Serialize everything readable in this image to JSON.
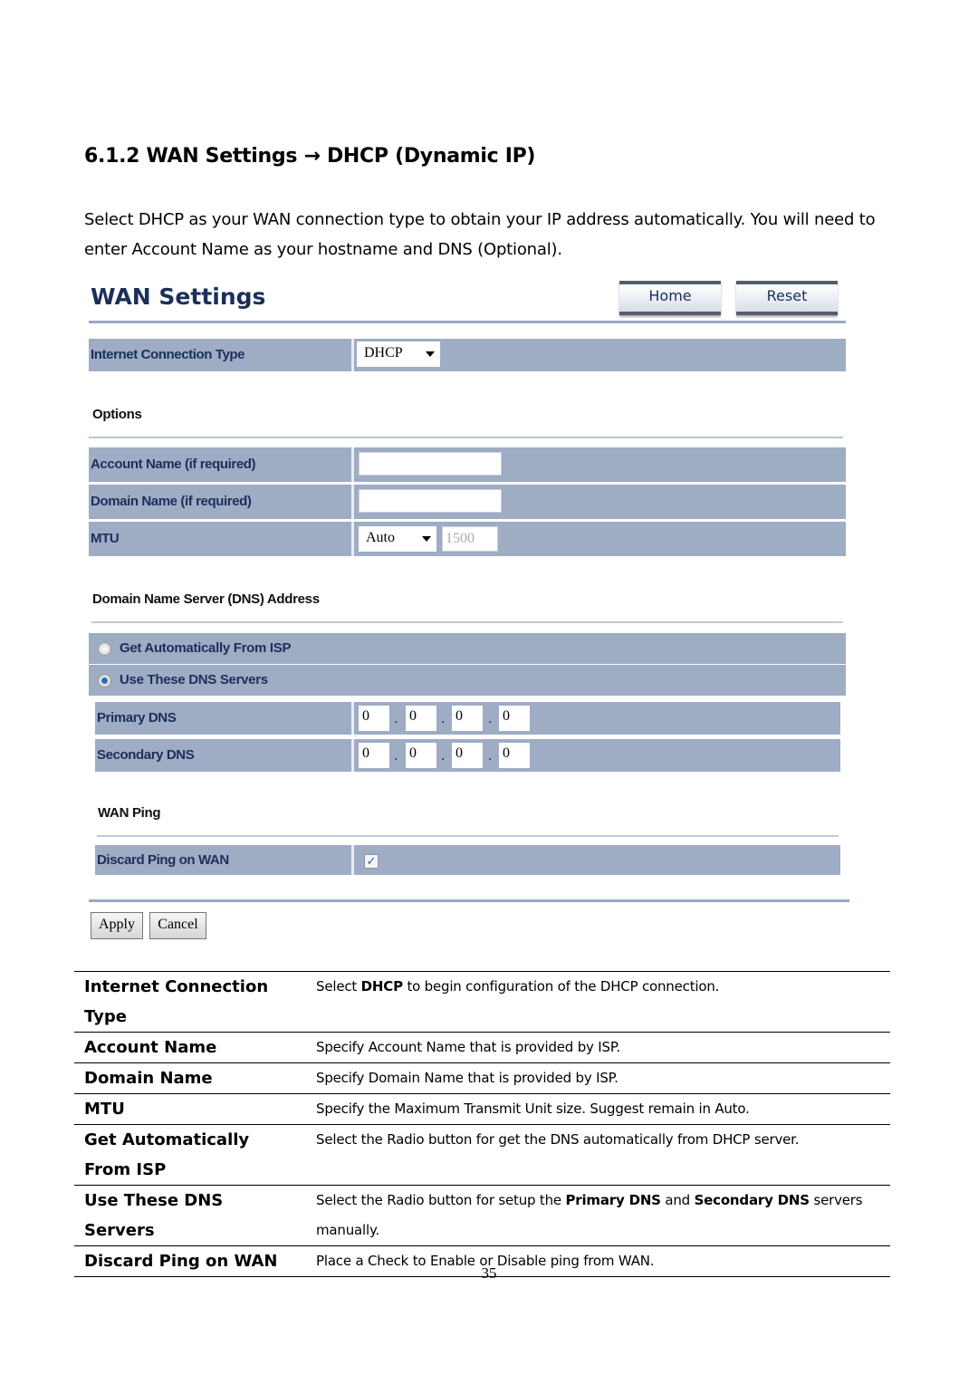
{
  "heading": "6.1.2 WAN Settings → DHCP (Dynamic IP)",
  "intro": "Select DHCP as your WAN connection type to obtain your IP address automatically. You will need to enter Account Name as your hostname and DNS (Optional).",
  "ui": {
    "title": "WAN Settings",
    "home_label": "Home",
    "reset_label": "Reset",
    "connection_type_label": "Internet Connection Type",
    "connection_type_value": "DHCP",
    "options_heading": "Options",
    "account_name_label": "Account Name (if required)",
    "account_name_value": "",
    "domain_name_label": "Domain Name (if required)",
    "domain_name_value": "",
    "mtu_label": "MTU",
    "mtu_mode": "Auto",
    "mtu_value": "1500",
    "dns_heading": "Domain Name Server (DNS) Address",
    "dns_auto_label": "Get Automatically From ISP",
    "dns_manual_label": "Use These DNS Servers",
    "dns_selected": "Use These DNS Servers",
    "primary_dns_label": "Primary DNS",
    "primary_dns": [
      "0",
      "0",
      "0",
      "0"
    ],
    "secondary_dns_label": "Secondary DNS",
    "secondary_dns": [
      "0",
      "0",
      "0",
      "0"
    ],
    "ping_heading": "WAN Ping",
    "discard_ping_label": "Discard Ping on WAN",
    "discard_ping_checked": true,
    "check_glyph": "✓",
    "apply_label": "Apply",
    "cancel_label": "Cancel",
    "colors": {
      "row_bg": "#9eacc4",
      "label_text": "#1b2f5a",
      "rule": "#9aaac4"
    }
  },
  "table": [
    {
      "key": "Internet Connection Type",
      "pre": "Select ",
      "b1": "DHCP",
      "mid": " to begin configuration of the DHCP connection.",
      "b2": "",
      "post": ""
    },
    {
      "key": "Account Name",
      "pre": "Specify Account Name that is provided by ISP.",
      "b1": "",
      "mid": "",
      "b2": "",
      "post": ""
    },
    {
      "key": "Domain Name",
      "pre": "Specify Domain Name that is provided by ISP.",
      "b1": "",
      "mid": "",
      "b2": "",
      "post": ""
    },
    {
      "key": "MTU",
      "pre": "Specify the Maximum Transmit Unit size. Suggest remain in Auto.",
      "b1": "",
      "mid": "",
      "b2": "",
      "post": ""
    },
    {
      "key": "Get Automatically From ISP",
      "pre": "Select the Radio button for get the DNS automatically from DHCP server.",
      "b1": "",
      "mid": "",
      "b2": "",
      "post": ""
    },
    {
      "key": "Use These DNS Servers",
      "pre": "Select the Radio button for setup the ",
      "b1": "Primary DNS",
      "mid": " and ",
      "b2": "Secondary DNS",
      "post": " servers manually."
    },
    {
      "key": "Discard Ping on WAN",
      "pre": "Place a Check to Enable or Disable ping from WAN.",
      "b1": "",
      "mid": "",
      "b2": "",
      "post": ""
    }
  ],
  "page_number": "35"
}
